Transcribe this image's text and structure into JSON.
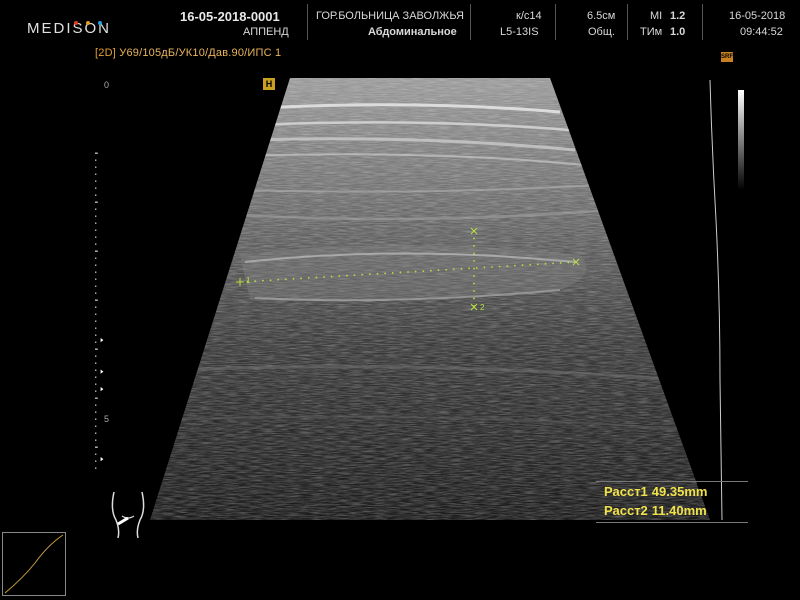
{
  "header": {
    "brand": "MEDISON",
    "brand_dots": [
      "#e04020",
      "#e0a020",
      "#20a0e0"
    ],
    "patient_id": "16-05-2018-0001",
    "patient_name": "АППЕНД",
    "hospital": "ГОР.БОЛЬНИЦА ЗАВОЛЖЬЯ",
    "preset": "Абдоминальное",
    "kc": "к/с14",
    "probe": "L5-13IS",
    "depth": "6.5см",
    "app": "Общ.",
    "mi_label": "MI",
    "mi_value": "1.2",
    "tim_label": "ТИм",
    "tim_value": "1.0",
    "date": "16-05-2018",
    "time": "09:44:52"
  },
  "params": {
    "mode": "[2D]",
    "settings": "У69/105дБ/УК10/Дав.90/ИПС 1"
  },
  "markers": {
    "focus": "H",
    "srf": "SRF"
  },
  "scale": {
    "label_0": "0",
    "label_5": "5"
  },
  "measurements": [
    {
      "label": "Расст1",
      "value": "49.35mm",
      "marker": "1"
    },
    {
      "label": "Расст2",
      "value": "11.40mm",
      "marker": "2"
    }
  ],
  "colors": {
    "measure": "#f0e24a",
    "caliper": "#b8e040",
    "params": "#e0a030"
  }
}
